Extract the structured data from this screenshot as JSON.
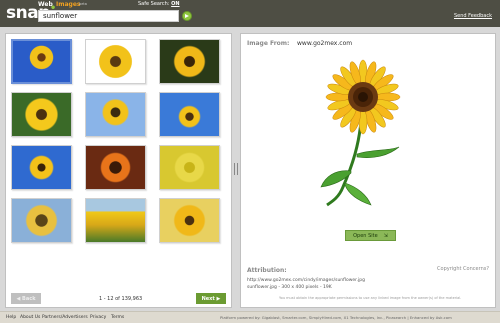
{
  "header": {
    "logo": "snap",
    "tabs": [
      {
        "label": "Web",
        "active": false
      },
      {
        "label": "Images",
        "active": true,
        "badge": "beta"
      }
    ],
    "search": {
      "value": "sunflower"
    },
    "safe_search": {
      "label": "Safe Search:",
      "value": "ON"
    },
    "send_feedback": "Send Feedback"
  },
  "results": {
    "thumbnails": [
      {
        "name": "thumb-1",
        "selected": true
      },
      {
        "name": "thumb-2"
      },
      {
        "name": "thumb-3"
      },
      {
        "name": "thumb-4"
      },
      {
        "name": "thumb-5"
      },
      {
        "name": "thumb-6"
      },
      {
        "name": "thumb-7"
      },
      {
        "name": "thumb-8"
      },
      {
        "name": "thumb-9"
      },
      {
        "name": "thumb-10"
      },
      {
        "name": "thumb-11"
      },
      {
        "name": "thumb-12"
      }
    ],
    "back_label": "◀ Back",
    "count": "1 - 12 of 139,963",
    "next_label": "Next ▶"
  },
  "preview": {
    "image_from_label": "Image From:",
    "image_from_value": "www.go2mex.com",
    "open_site_label": "Open Site",
    "copyright": "Copyright Concerns?",
    "attribution_label": "Attribution:",
    "attribution_url": "http://www.go2mex.com/cindy/images/sunflower.jpg",
    "attribution_file": "sunflower.jpg - 300 x 400 pixels - 19K",
    "attribution_notice": "You must obtain the appropriate permissions to use any linked image from the owner(s) of the material."
  },
  "footer": {
    "links": [
      "Help",
      "About Us",
      "Partners/Advertisers",
      "Privacy",
      "Terms"
    ],
    "powered_by": "Platform powered by: Gigablast, Smarter.com, SimplyHired.com, X1 Technologies, Inc., Picasearch | Enhanced by Ask.com"
  },
  "colors": {
    "header_bg": "#4e4e44",
    "accent_green": "#6b9b32",
    "images_tab": "#f0a020",
    "panel_bg": "#d8d8d8"
  }
}
